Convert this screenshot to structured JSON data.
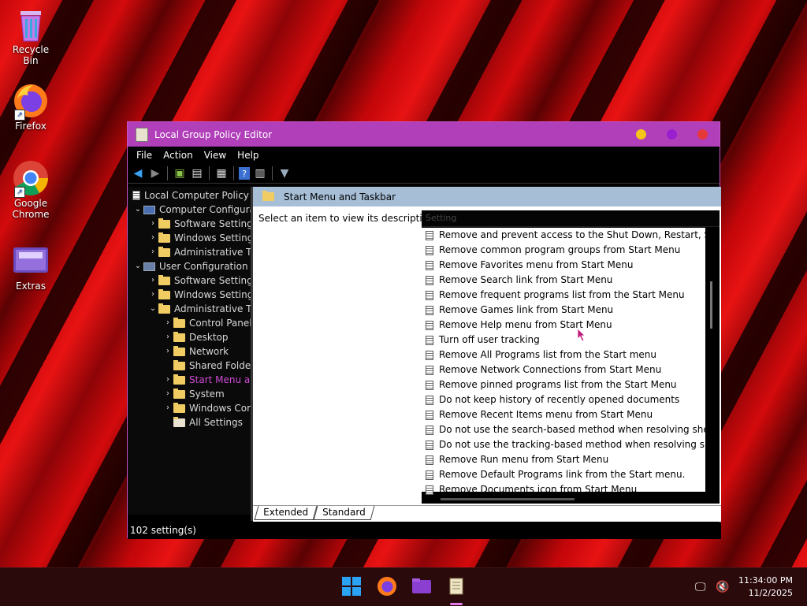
{
  "desktop": {
    "icons": [
      {
        "label": "Recycle Bin"
      },
      {
        "label": "Firefox"
      },
      {
        "label": "Google Chrome"
      },
      {
        "label": "Extras"
      }
    ]
  },
  "window": {
    "title": "Local Group Policy Editor",
    "controls": {
      "minimize_color": "#f5c518",
      "maximize_color": "#9b1fcf",
      "close_color": "#e53939"
    },
    "menu": [
      "File",
      "Action",
      "View",
      "Help"
    ],
    "toolbar_icons": [
      "back-arrow-icon",
      "forward-arrow-icon",
      "up-folder-icon",
      "show-hide-tree-icon",
      "export-list-icon",
      "help-icon",
      "properties-icon",
      "filter-icon"
    ]
  },
  "tree": {
    "root": "Local Computer Policy",
    "items": [
      {
        "label": "Computer Configura",
        "level": 1,
        "chevron": "down"
      },
      {
        "label": "Software Settings",
        "level": 2,
        "chevron": "right"
      },
      {
        "label": "Windows Setting",
        "level": 2,
        "chevron": "right"
      },
      {
        "label": "Administrative Te",
        "level": 2,
        "chevron": "right"
      },
      {
        "label": "User Configuration",
        "level": 1,
        "chevron": "down"
      },
      {
        "label": "Software Settings",
        "level": 2,
        "chevron": "right"
      },
      {
        "label": "Windows Setting",
        "level": 2,
        "chevron": "right"
      },
      {
        "label": "Administrative Te",
        "level": 2,
        "chevron": "down"
      },
      {
        "label": "Control Panel",
        "level": 3,
        "chevron": "right"
      },
      {
        "label": "Desktop",
        "level": 3,
        "chevron": "right"
      },
      {
        "label": "Network",
        "level": 3,
        "chevron": "right"
      },
      {
        "label": "Shared Folder",
        "level": 3,
        "chevron": ""
      },
      {
        "label": "Start Menu ar",
        "level": 3,
        "chevron": "right",
        "selected": true
      },
      {
        "label": "System",
        "level": 3,
        "chevron": "right"
      },
      {
        "label": "Windows Cor",
        "level": 3,
        "chevron": "right"
      },
      {
        "label": "All Settings",
        "level": 3,
        "chevron": ""
      }
    ]
  },
  "details": {
    "header": "Start Menu and Taskbar",
    "description_prompt": "Select an item to view its description.",
    "column_header": "Setting",
    "settings": [
      "Remove and prevent access to the Shut Down, Restart, Sleep...",
      "Remove common program groups from Start Menu",
      "Remove Favorites menu from Start Menu",
      "Remove Search link from Start Menu",
      "Remove frequent programs list from the Start Menu",
      "Remove Games link from Start Menu",
      "Remove Help menu from Start Menu",
      "Turn off user tracking",
      "Remove All Programs list from the Start menu",
      "Remove Network Connections from Start Menu",
      "Remove pinned programs list from the Start Menu",
      "Do not keep history of recently opened documents",
      "Remove Recent Items menu from Start Menu",
      "Do not use the search-based method when resolving shell s...",
      "Do not use the tracking-based method when resolving shell ...",
      "Remove Run menu from Start Menu",
      "Remove Default Programs link from the Start menu.",
      "Remove Documents icon from Start Menu"
    ],
    "tabs": [
      "Extended",
      "Standard"
    ]
  },
  "status_bar": "102 setting(s)",
  "taskbar": {
    "time": "11:34:00 PM",
    "date": "11/2/2025"
  }
}
